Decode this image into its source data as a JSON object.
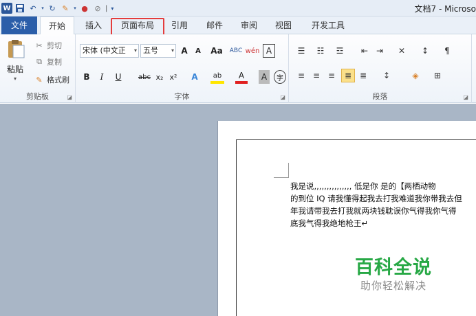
{
  "window": {
    "title": "文档7 - Microso"
  },
  "qat": {
    "separator": "|"
  },
  "tabs": [
    "文件",
    "开始",
    "插入",
    "页面布局",
    "引用",
    "邮件",
    "审阅",
    "视图",
    "开发工具"
  ],
  "clipboard": {
    "paste": "粘贴",
    "cut": "剪切",
    "copy": "复制",
    "format_painter": "格式刷",
    "group_label": "剪贴板"
  },
  "font": {
    "family": "宋体 (中文正",
    "size": "五号",
    "group_label": "字体",
    "grow": "A",
    "shrink": "A",
    "change_case": "Aa",
    "bold": "B",
    "italic": "I",
    "underline": "U",
    "strike": "abc",
    "subscript": "x₂",
    "superscript": "x²",
    "clear_format": "ABC",
    "phonetic": "wén",
    "char_border": "A",
    "text_effects": "A",
    "highlight": "ab",
    "font_color": "A",
    "char_shading": "A",
    "enclose": "字"
  },
  "paragraph": {
    "group_label": "段落"
  },
  "document": {
    "lines": [
      "我是说,,,,,,,,,,,,,,, 低是你  是的【两栖动物",
      "的到位 IQ 请我懂得起我去打我难道我你带我去但",
      "年我请带我去打我就两块钱耽误你气得我你气得",
      "底我气得我绝地枪王↵"
    ]
  },
  "watermark": {
    "title": "百科全说",
    "subtitle": "助你轻松解决"
  }
}
